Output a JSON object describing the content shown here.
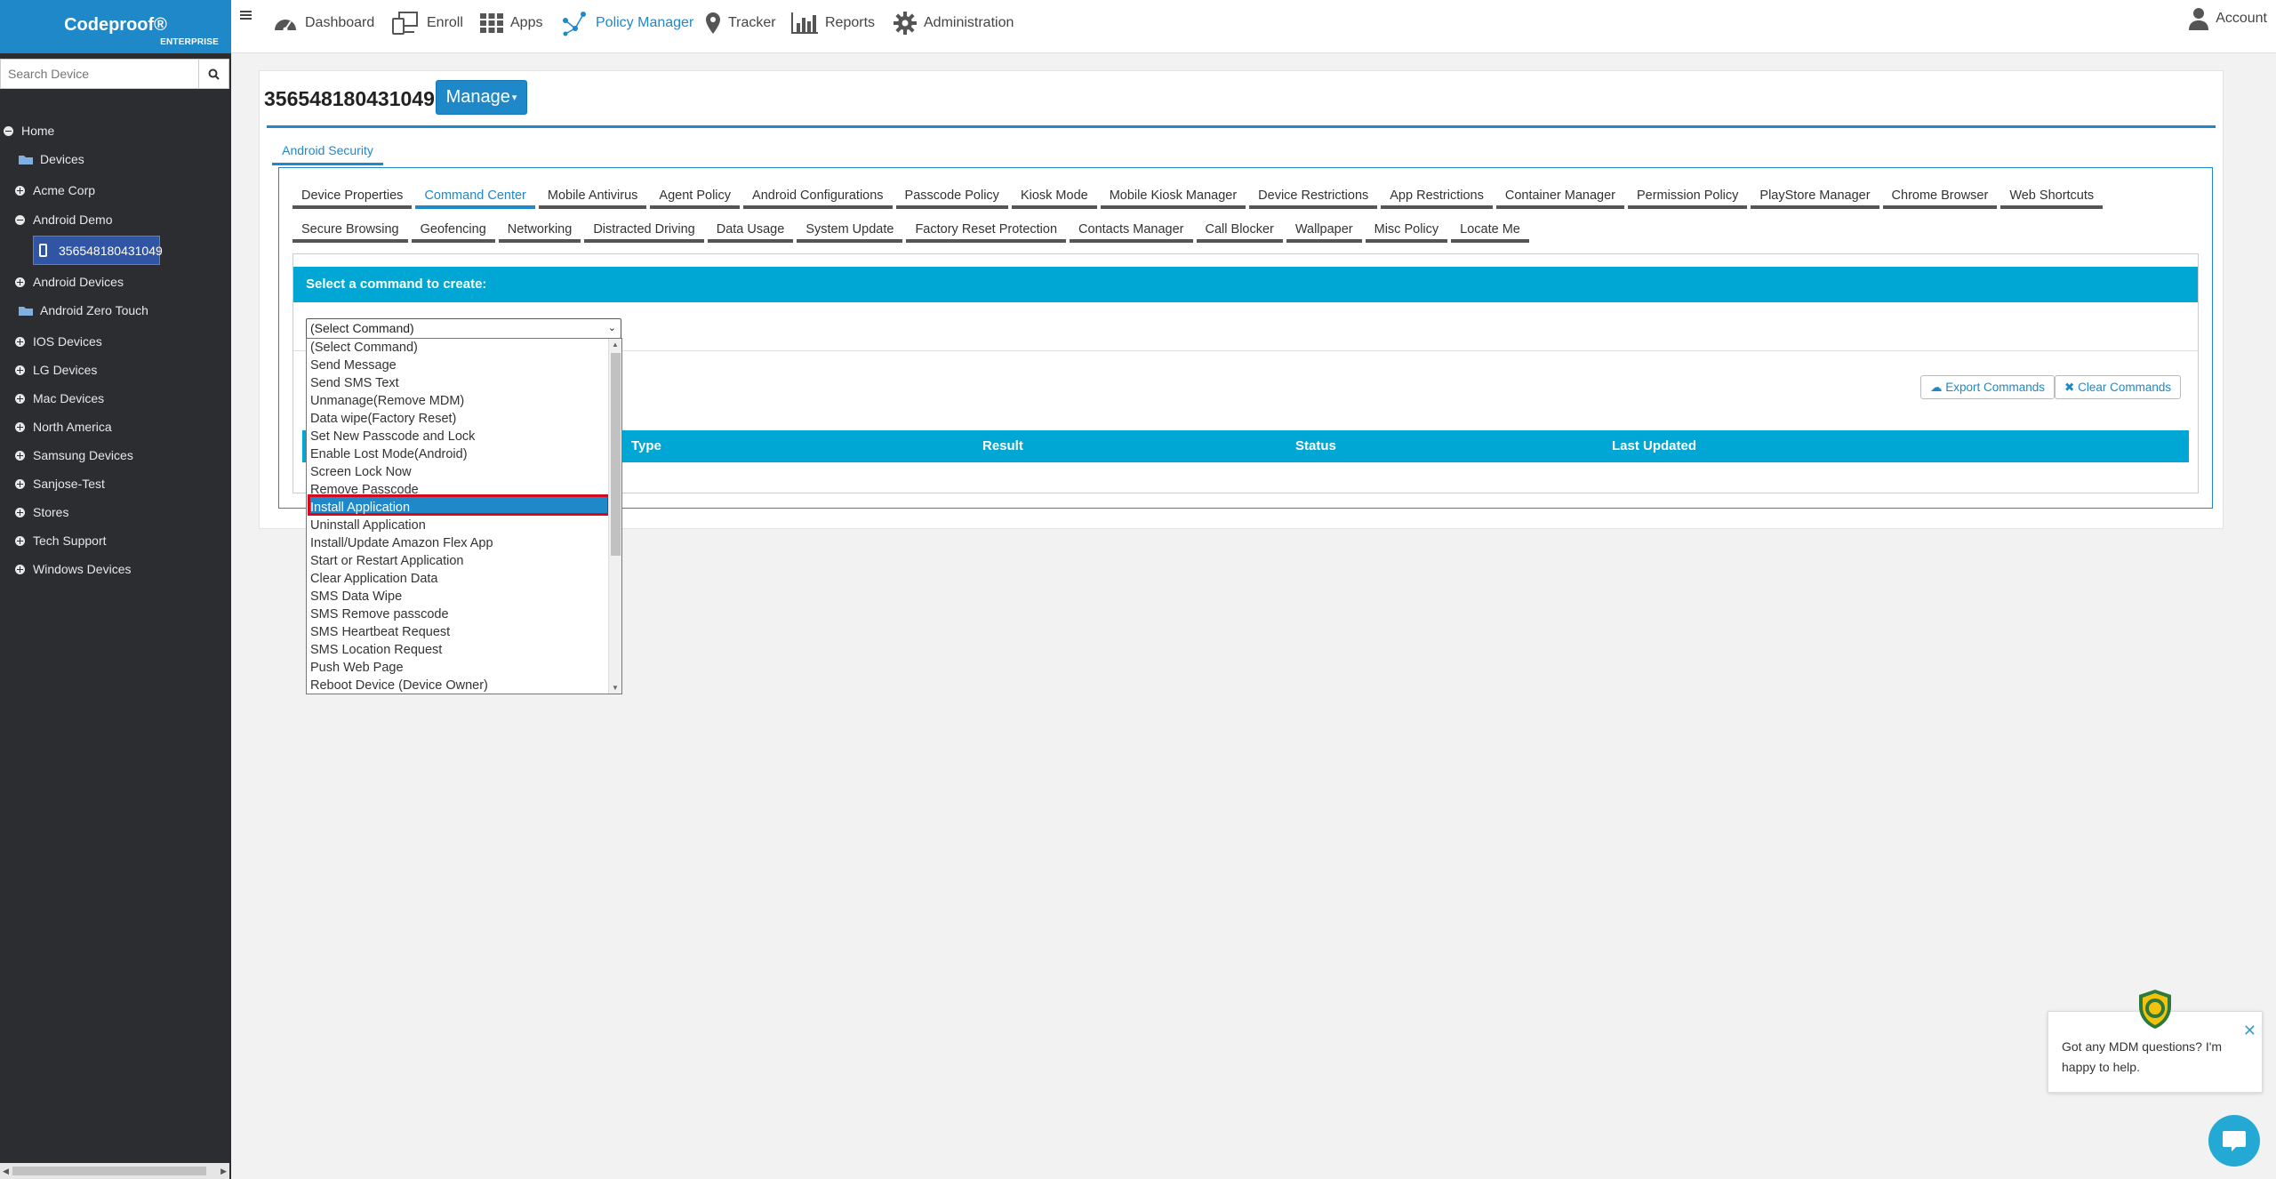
{
  "brand": {
    "name": "Codeproof®",
    "edition": "ENTERPRISE"
  },
  "search": {
    "placeholder": "Search Device"
  },
  "tree": {
    "home": "Home",
    "devices": "Devices",
    "acme": "Acme Corp",
    "android_demo": "Android Demo",
    "selected_device": "356548180431049",
    "android_devices": "Android Devices",
    "android_zero_touch": "Android Zero Touch",
    "ios": "IOS Devices",
    "lg": "LG Devices",
    "mac": "Mac Devices",
    "north_america": "North America",
    "samsung": "Samsung Devices",
    "sanjose": "Sanjose-Test",
    "stores": "Stores",
    "tech_support": "Tech Support",
    "windows": "Windows Devices"
  },
  "nav": {
    "dashboard": "Dashboard",
    "enroll": "Enroll",
    "apps": "Apps",
    "policy_manager": "Policy Manager",
    "tracker": "Tracker",
    "reports": "Reports",
    "administration": "Administration",
    "account": "Account"
  },
  "page": {
    "device_id": "356548180431049",
    "manage": "Manage",
    "section_tab": "Android Security"
  },
  "tabs_row1": [
    "Device Properties",
    "Command Center",
    "Mobile Antivirus",
    "Agent Policy",
    "Android Configurations",
    "Passcode Policy",
    "Kiosk Mode",
    "Mobile Kiosk Manager",
    "Device Restrictions",
    "App Restrictions",
    "Container Manager",
    "Permission Policy",
    "PlayStore Manager",
    "Chrome Browser",
    "Web Shortcuts"
  ],
  "tabs_row2": [
    "Secure Browsing",
    "Geofencing",
    "Networking",
    "Distracted Driving",
    "Data Usage",
    "System Update",
    "Factory Reset Protection",
    "Contacts Manager",
    "Call Blocker",
    "Wallpaper",
    "Misc Policy",
    "Locate Me"
  ],
  "active_tab": "Command Center",
  "command": {
    "header": "Select a command to create:",
    "selected": "(Select Command)",
    "options": [
      "(Select Command)",
      "Send Message",
      "Send SMS Text",
      "Unmanage(Remove MDM)",
      "Data wipe(Factory Reset)",
      "Set New Passcode and Lock",
      "Enable Lost Mode(Android)",
      "Screen Lock Now",
      "Remove Passcode",
      "Install Application",
      "Uninstall Application",
      "Install/Update Amazon Flex App",
      "Start or Restart Application",
      "Clear Application Data",
      "SMS Data Wipe",
      "SMS Remove passcode",
      "SMS Heartbeat Request",
      "SMS Location Request",
      "Push Web Page",
      "Reboot Device (Device Owner)"
    ],
    "highlighted": "Install Application",
    "export": "Export Commands",
    "clear": "Clear Commands"
  },
  "table": {
    "columns": [
      "Type",
      "Result",
      "Status",
      "Last Updated"
    ]
  },
  "chat": {
    "message": "Got any MDM questions? I'm happy to help."
  },
  "colors": {
    "accent": "#1e88c9",
    "header_bar": "#00a7d4",
    "sidebar": "#2b2d30",
    "highlight_border": "#d50a1c"
  }
}
